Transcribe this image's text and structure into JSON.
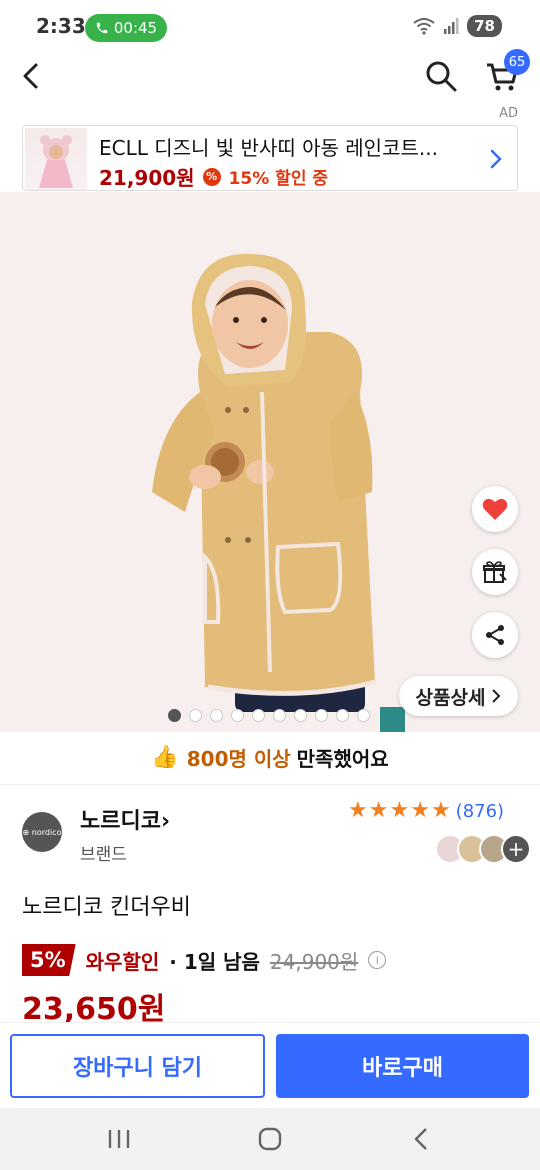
{
  "status_bar": {
    "time": "2:33",
    "call_timer": "00:45",
    "battery": "78"
  },
  "nav": {
    "cart_count": "65"
  },
  "ad": {
    "label": "AD",
    "title": "ECLL 디즈니 빛 반사띠 아동 레인코트...",
    "price": "21,900원",
    "discount_icon": "%",
    "discount_text": "15% 할인 중"
  },
  "gallery": {
    "detail_label": "상품상세",
    "dot_count": 10,
    "active_index": 0
  },
  "satisfaction": {
    "count": "800명 이상",
    "rest": "만족했어요"
  },
  "brand": {
    "logo_text": "⊕ nordico",
    "name": "노르디코",
    "sub": "브랜드"
  },
  "rating": {
    "stars": 5,
    "review_count": "(876)"
  },
  "product": {
    "title": "노르디코 킨더우비"
  },
  "price": {
    "wow_badge": "5%",
    "wow_label": "와우할인",
    "remain": "· 1일 남음",
    "original": "24,900원",
    "info_icon": "i",
    "sale": "23,650원"
  },
  "actions": {
    "cart_add": "장바구니 담기",
    "buy_now": "바로구매"
  },
  "colors": {
    "accent_blue": "#346aff",
    "price_red": "#ae0000",
    "star_orange": "#f3801e",
    "call_green": "#37b34a"
  },
  "icons": [
    "back-arrow-icon",
    "search-icon",
    "cart-icon",
    "heart-icon",
    "gift-icon",
    "share-icon",
    "chevron-right-icon",
    "thumbs-up-icon",
    "info-icon",
    "recents-icon",
    "home-icon",
    "back-icon"
  ]
}
